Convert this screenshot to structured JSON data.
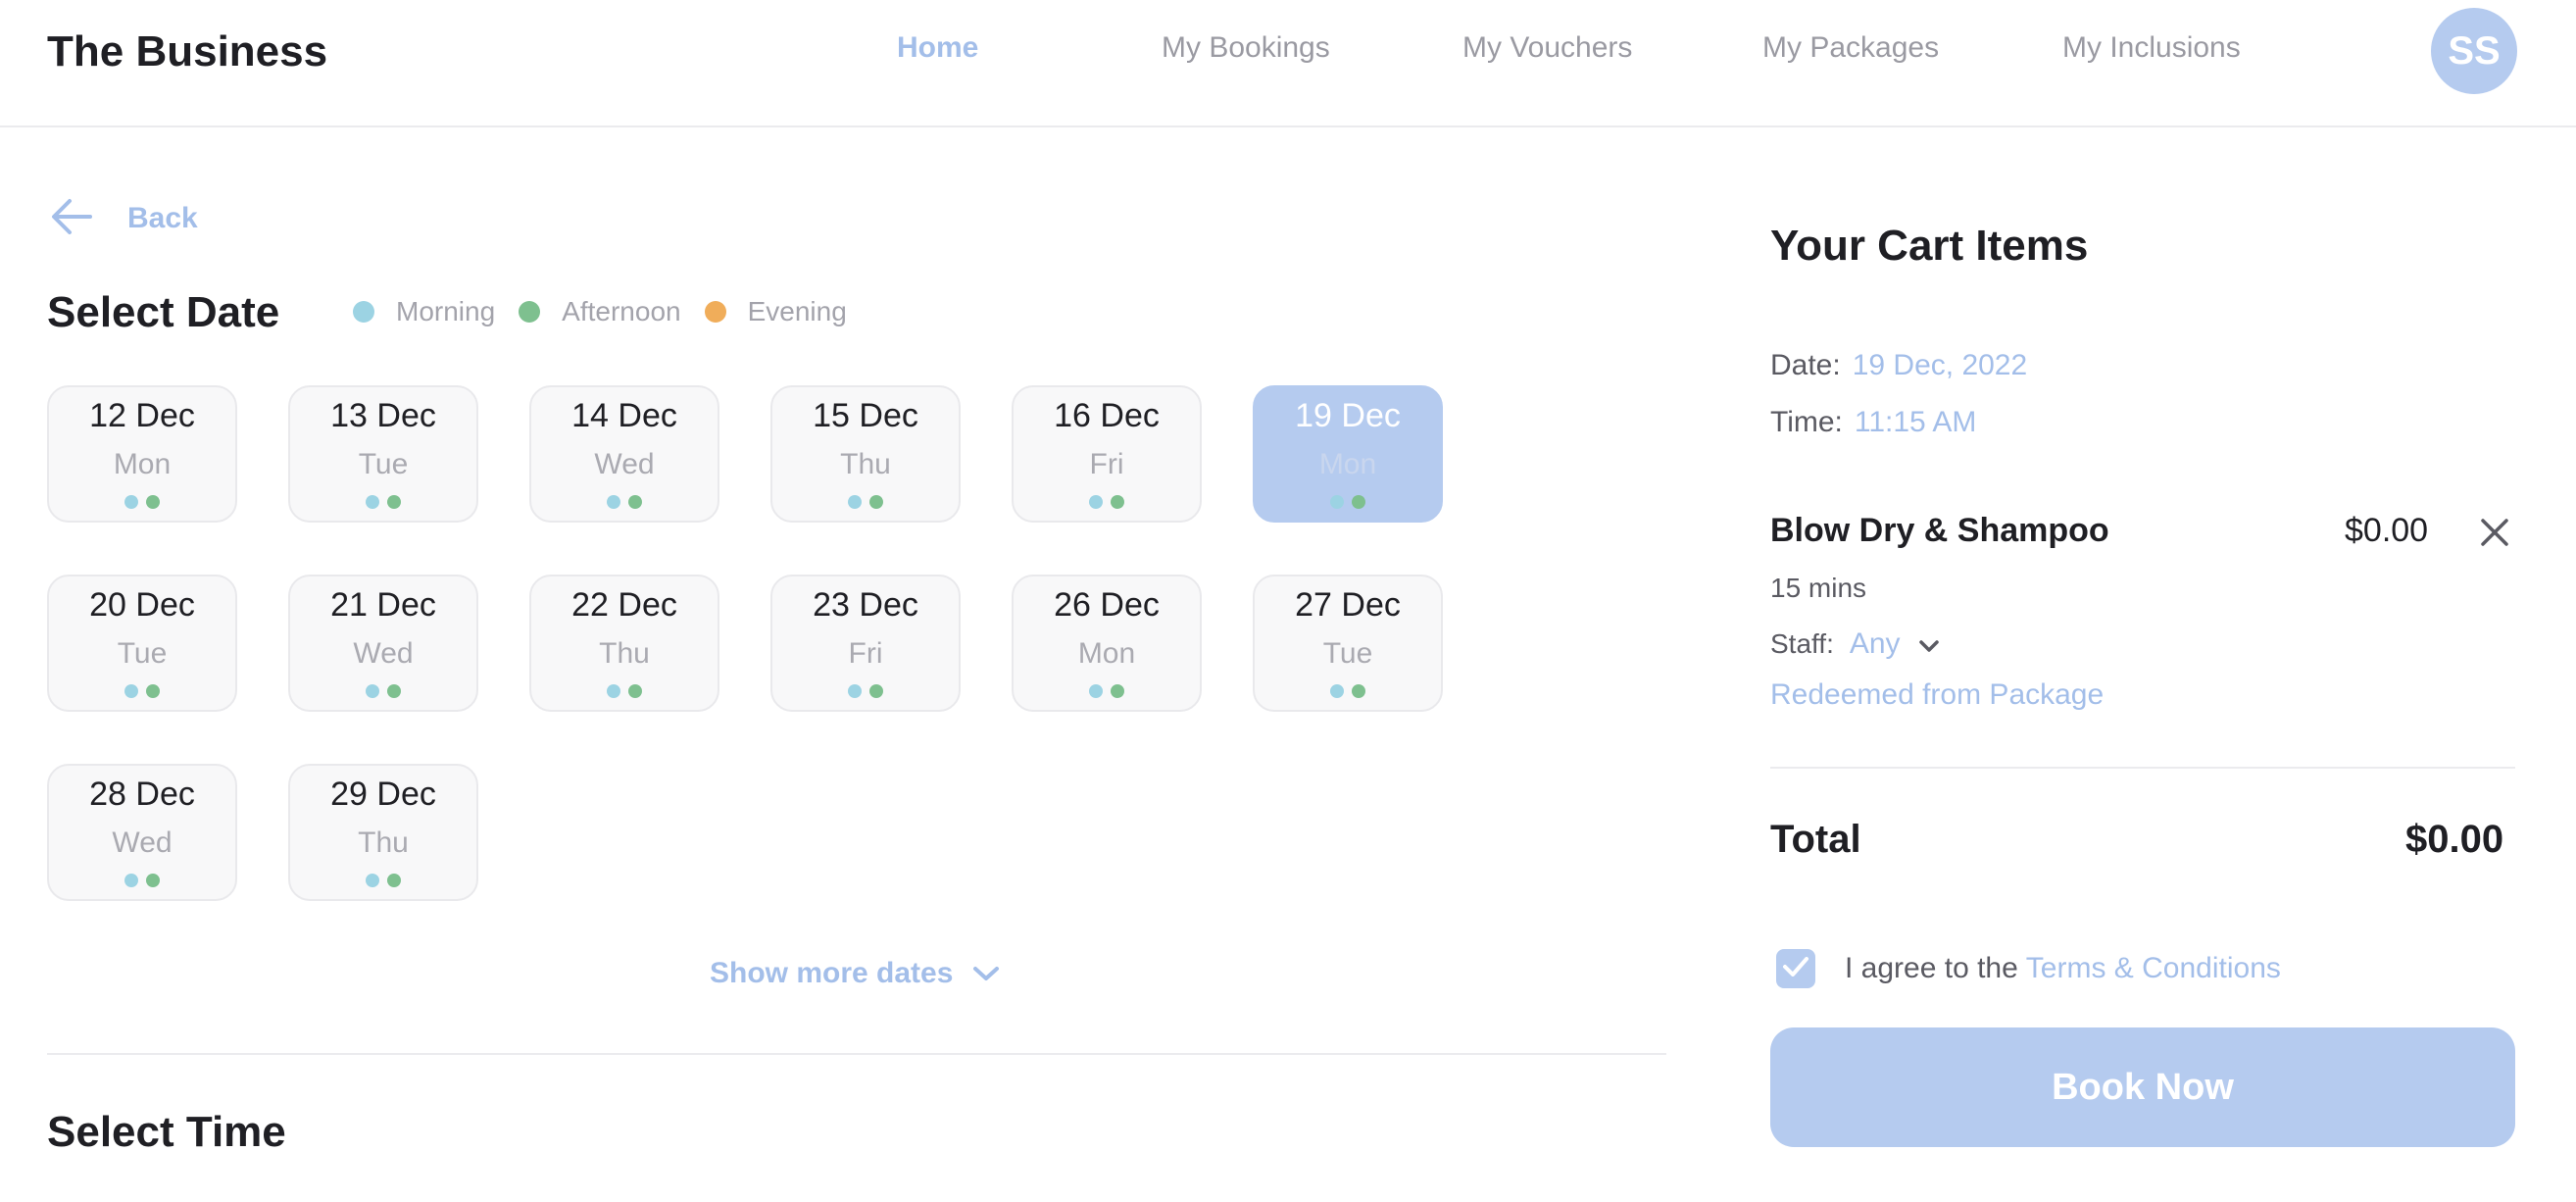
{
  "header": {
    "brand": "The Business",
    "nav": [
      "Home",
      "My Bookings",
      "My Vouchers",
      "My Packages",
      "My Inclusions"
    ],
    "active_nav": "Home",
    "avatar_initials": "SS"
  },
  "back": {
    "label": "Back",
    "icon": "arrow-left-icon"
  },
  "select_date": {
    "title": "Select Date",
    "legend": [
      {
        "label": "Morning",
        "color": "#9cd3e3"
      },
      {
        "label": "Afternoon",
        "color": "#7ec08f"
      },
      {
        "label": "Evening",
        "color": "#f0ad5a"
      }
    ],
    "dates": [
      {
        "date": "12 Dec",
        "day": "Mon"
      },
      {
        "date": "13 Dec",
        "day": "Tue"
      },
      {
        "date": "14 Dec",
        "day": "Wed"
      },
      {
        "date": "15 Dec",
        "day": "Thu"
      },
      {
        "date": "16 Dec",
        "day": "Fri"
      },
      {
        "date": "19 Dec",
        "day": "Mon",
        "selected": true
      },
      {
        "date": "20 Dec",
        "day": "Tue"
      },
      {
        "date": "21 Dec",
        "day": "Wed"
      },
      {
        "date": "22 Dec",
        "day": "Thu"
      },
      {
        "date": "23 Dec",
        "day": "Fri"
      },
      {
        "date": "26 Dec",
        "day": "Mon"
      },
      {
        "date": "27 Dec",
        "day": "Tue"
      },
      {
        "date": "28 Dec",
        "day": "Wed"
      },
      {
        "date": "29 Dec",
        "day": "Thu"
      }
    ],
    "availability_colors": [
      "#9cd3e3",
      "#7ec08f"
    ],
    "show_more": "Show more dates"
  },
  "select_time": {
    "title": "Select Time"
  },
  "cart": {
    "title": "Your Cart Items",
    "date_label": "Date:",
    "date_value": "19 Dec, 2022",
    "time_label": "Time:",
    "time_value": "11:15 AM",
    "item": {
      "name": "Blow Dry & Shampoo",
      "price": "$0.00",
      "duration": "15 mins",
      "staff_label": "Staff:",
      "staff_value": "Any",
      "note": "Redeemed from Package"
    },
    "total_label": "Total",
    "total_value": "$0.00",
    "agree_text": "I agree to the",
    "terms_link": "Terms & Conditions",
    "agree_checked": true,
    "book_button": "Book Now"
  },
  "colors": {
    "accent": "#a3bee9",
    "accent_fill": "#b5cbef",
    "text": "#1f1f24",
    "muted": "#9a9aa2"
  }
}
